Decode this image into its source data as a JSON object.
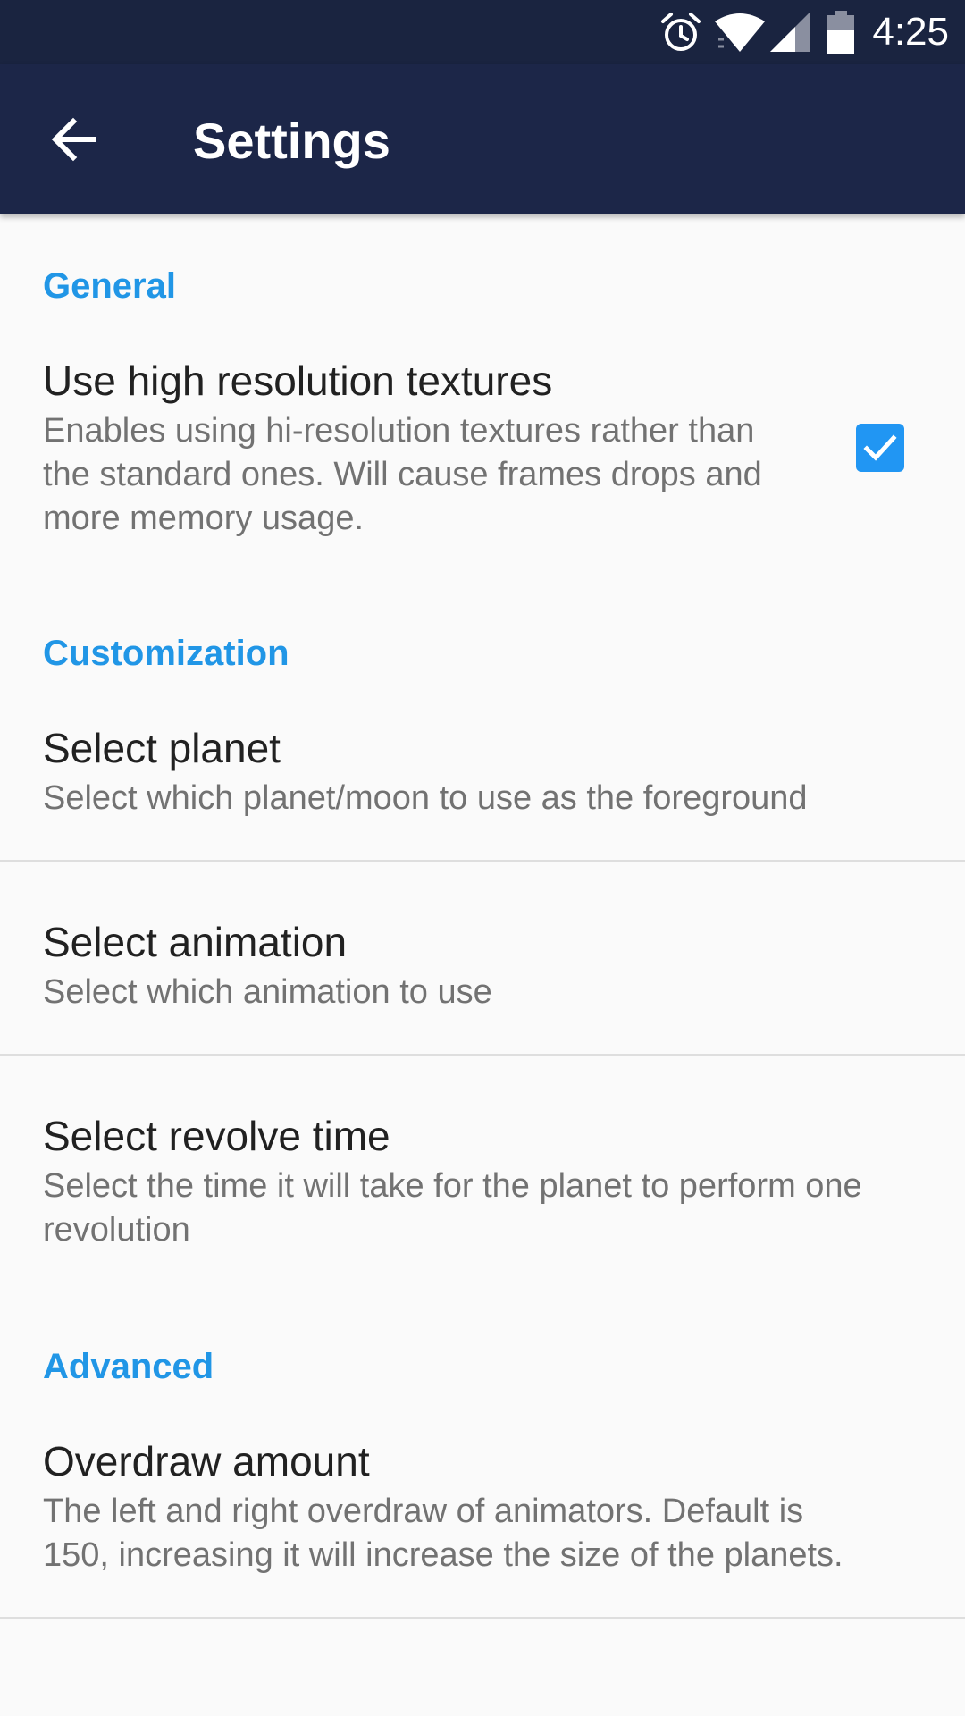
{
  "status_bar": {
    "time": "4:25",
    "icons": [
      "alarm-icon",
      "wifi-icon",
      "signal-icon",
      "battery-icon"
    ]
  },
  "app_bar": {
    "back_icon": "arrow-back-icon",
    "title": "Settings",
    "color": "#1c2648"
  },
  "accent_color": "#2196e6",
  "sections": [
    {
      "header": "General",
      "items": [
        {
          "title": "Use high resolution textures",
          "summary": "Enables using hi-resolution textures rather than the standard ones. Will cause frames drops and more memory usage.",
          "checked": true
        }
      ]
    },
    {
      "header": "Customization",
      "items": [
        {
          "title": "Select planet",
          "summary": "Select which planet/moon to use as the foreground"
        },
        {
          "title": "Select animation",
          "summary": "Select which animation to use"
        },
        {
          "title": "Select revolve time",
          "summary": "Select the time it will take for the planet to perform one revolution"
        }
      ]
    },
    {
      "header": "Advanced",
      "items": [
        {
          "title": "Overdraw amount",
          "summary": "The left and right overdraw of animators. Default is 150, increasing it will increase the size of the planets."
        }
      ]
    }
  ]
}
